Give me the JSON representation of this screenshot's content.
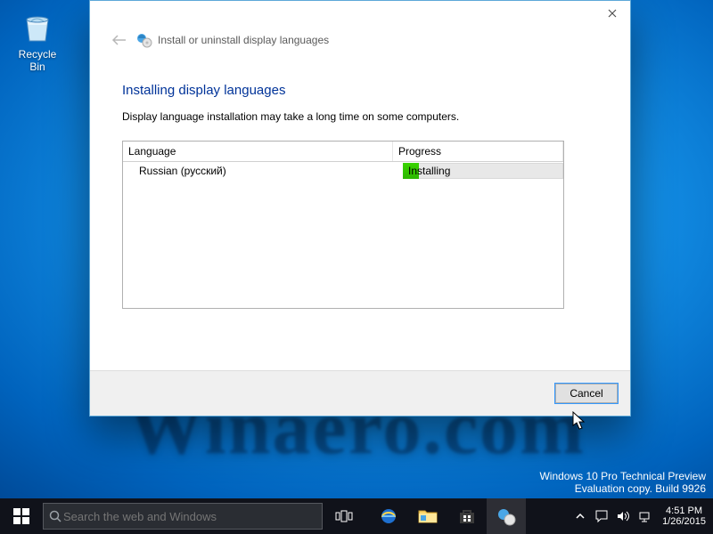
{
  "desktop": {
    "recycle_bin_label": "Recycle Bin",
    "watermark": "Winaero.com",
    "preview_line1": "Windows 10 Pro Technical Preview",
    "preview_line2": "Evaluation copy. Build 9926"
  },
  "dialog": {
    "header": "Install or uninstall display languages",
    "title": "Installing display languages",
    "notice": "Display language installation may take a long time on some computers.",
    "columns": {
      "language": "Language",
      "progress": "Progress"
    },
    "rows": [
      {
        "language": "Russian (русский)",
        "progress_label": "Installing",
        "progress_percent": 4
      }
    ],
    "cancel": "Cancel"
  },
  "taskbar": {
    "search_placeholder": "Search the web and Windows",
    "clock_time": "4:51 PM",
    "clock_date": "1/26/2015"
  }
}
